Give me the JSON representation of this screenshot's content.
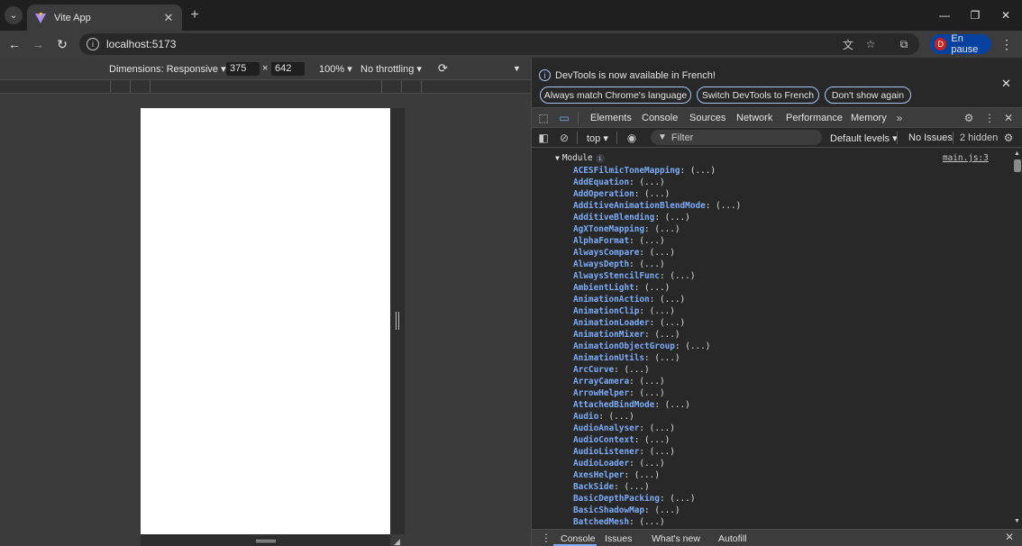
{
  "browser": {
    "tab": {
      "title": "Vite App",
      "close": "✕"
    },
    "new_tab": "+",
    "window_controls": {
      "minimize": "—",
      "maximize": "❐",
      "close": "✕"
    },
    "url": "localhost:5173",
    "profile": {
      "initial": "D",
      "label": "En pause"
    }
  },
  "emulation": {
    "dimensions": "Dimensions: Responsive ▾",
    "width": "375",
    "times": "×",
    "height": "642",
    "zoom": "100% ▾",
    "throttling": "No throttling ▾"
  },
  "devtools": {
    "infobar": {
      "message": "DevTools is now available in French!",
      "btn_match": "Always match Chrome's language",
      "btn_switch": "Switch DevTools to French",
      "btn_dismiss": "Don't show again"
    },
    "tabs": [
      "Elements",
      "Console",
      "Sources",
      "Network",
      "Performance",
      "Memory"
    ],
    "console_bar": {
      "context": "top ▾",
      "filter_placeholder": "Filter",
      "levels": "Default levels ▾",
      "issues": "No Issues",
      "hidden": "2 hidden"
    },
    "module_label": "Module",
    "source_link": "main.js:3",
    "properties": [
      "ACESFilmicToneMapping",
      "AddEquation",
      "AddOperation",
      "AdditiveAnimationBlendMode",
      "AdditiveBlending",
      "AgXToneMapping",
      "AlphaFormat",
      "AlwaysCompare",
      "AlwaysDepth",
      "AlwaysStencilFunc",
      "AmbientLight",
      "AnimationAction",
      "AnimationClip",
      "AnimationLoader",
      "AnimationMixer",
      "AnimationObjectGroup",
      "AnimationUtils",
      "ArcCurve",
      "ArrayCamera",
      "ArrowHelper",
      "AttachedBindMode",
      "Audio",
      "AudioAnalyser",
      "AudioContext",
      "AudioListener",
      "AudioLoader",
      "AxesHelper",
      "BackSide",
      "BasicDepthPacking",
      "BasicShadowMap",
      "BatchedMesh"
    ],
    "property_value": "(...)",
    "drawer_tabs": [
      "Console",
      "Issues",
      "What's new",
      "Autofill"
    ]
  }
}
